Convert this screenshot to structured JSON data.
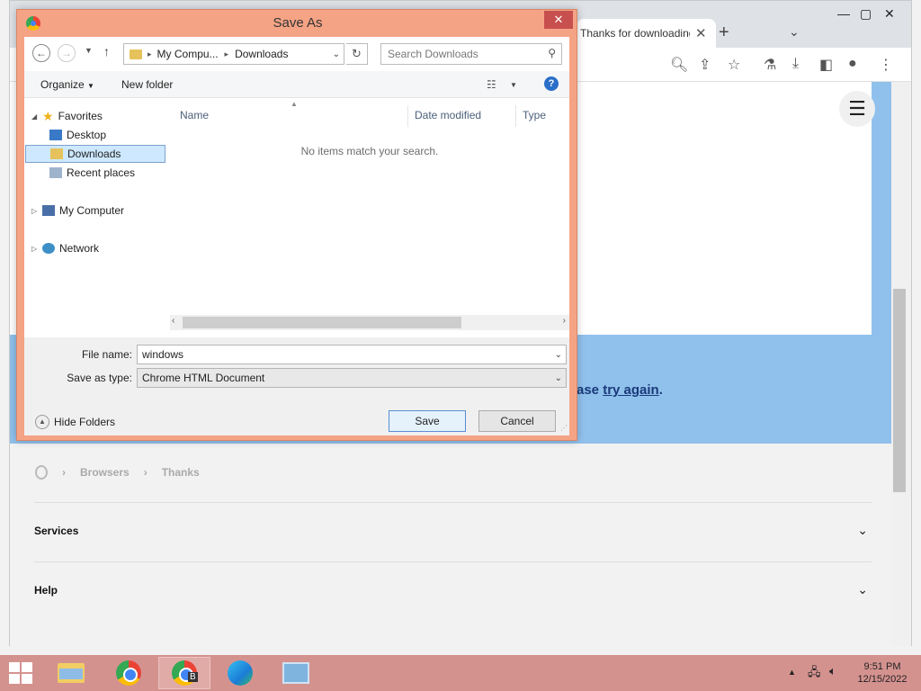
{
  "browser": {
    "tab_title": "Thanks for downloading",
    "new_tab": "+",
    "hero_message_prefix": "ase",
    "hero_link": "try again",
    "hero_message_suffix": ".",
    "breadcrumb": [
      "Browsers",
      "Thanks"
    ],
    "accordion": [
      "Services",
      "Help"
    ]
  },
  "dialog": {
    "title": "Save As",
    "close": "✕",
    "address": {
      "root": "My Compu...",
      "current": "Downloads"
    },
    "search_placeholder": "Search Downloads",
    "commands": {
      "organize": "Organize",
      "new_folder": "New folder"
    },
    "nav": {
      "favorites": "Favorites",
      "desktop": "Desktop",
      "downloads": "Downloads",
      "recent": "Recent places",
      "computer": "My Computer",
      "network": "Network"
    },
    "columns": {
      "name": "Name",
      "date": "Date modified",
      "type": "Type"
    },
    "empty_message": "No items match your search.",
    "file_name_label": "File name:",
    "file_name_value": "windows",
    "save_type_label": "Save as type:",
    "save_type_value": "Chrome HTML Document",
    "hide_folders": "Hide Folders",
    "save": "Save",
    "cancel": "Cancel"
  },
  "taskbar": {
    "time": "9:51 PM",
    "date": "12/15/2022",
    "chrome_badge": "B"
  },
  "colors": {
    "dialog_frame": "#f5a385",
    "taskbar": "#d4928f",
    "hero": "#90c1ec",
    "selection": "#cde8ff"
  }
}
